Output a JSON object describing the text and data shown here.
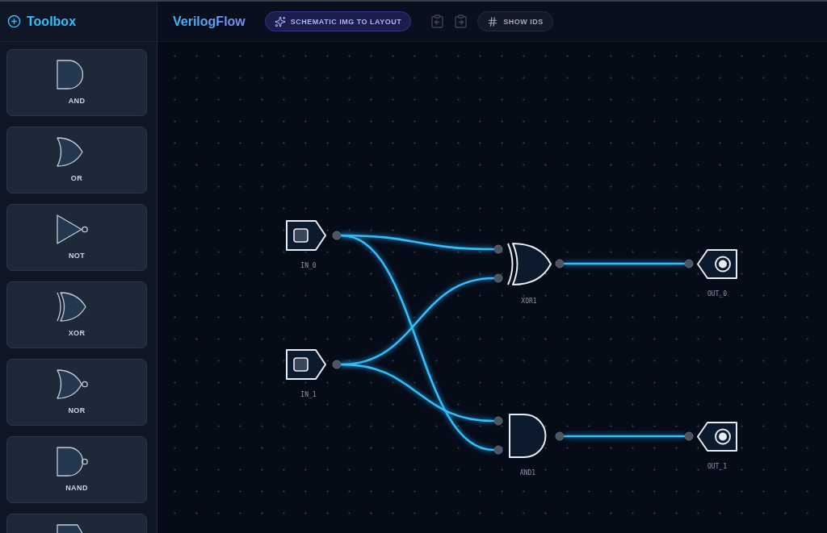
{
  "sidebar": {
    "title": "Toolbox",
    "items": [
      {
        "kind": "and",
        "label": "AND"
      },
      {
        "kind": "or",
        "label": "OR"
      },
      {
        "kind": "not",
        "label": "NOT"
      },
      {
        "kind": "xor",
        "label": "XOR"
      },
      {
        "kind": "nor",
        "label": "NOR"
      },
      {
        "kind": "nand",
        "label": "NAND"
      },
      {
        "kind": "input"
      }
    ]
  },
  "header": {
    "title": "VerilogFlow",
    "buttons": [
      {
        "kind": "ai",
        "label": "SCHEMATIC IMG TO LAYOUT"
      },
      {
        "kind": "import",
        "disabled": true
      },
      {
        "kind": "export",
        "disabled": true
      },
      {
        "kind": "ids",
        "label": "SHOW IDS"
      }
    ]
  },
  "canvas": {
    "nodes": [
      {
        "kind": "input",
        "label": "IN_0"
      },
      {
        "kind": "xor",
        "label": "XOR1"
      },
      {
        "kind": "output",
        "label": "OUT_0"
      },
      {
        "kind": "input",
        "label": "IN_1"
      },
      {
        "kind": "and",
        "label": "AND1"
      },
      {
        "kind": "output",
        "label": "OUT_1"
      }
    ],
    "wires": [
      {
        "kind": "curve"
      },
      {
        "kind": "curve"
      },
      {
        "kind": "curve"
      },
      {
        "kind": "curve"
      },
      {
        "kind": "straight"
      },
      {
        "kind": "straight"
      }
    ]
  }
}
